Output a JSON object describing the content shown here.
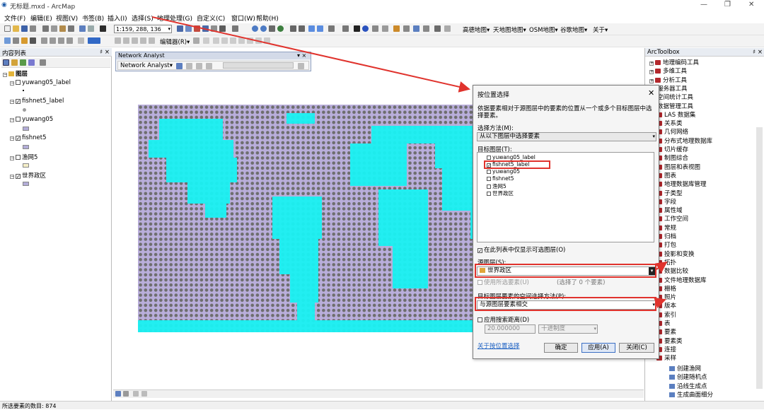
{
  "window": {
    "title": "无标题.mxd - ArcMap",
    "min": "—",
    "max": "❐",
    "close": "✕"
  },
  "menu": [
    "文件(F)",
    "编辑(E)",
    "视图(V)",
    "书签(B)",
    "插入(I)",
    "选择(S)",
    "地理处理(G)",
    "自定义(C)",
    "窗口(W)",
    "帮助(H)"
  ],
  "toolbar": {
    "scale": "1:159, 288, 136",
    "basemaps": [
      "高德地图▾",
      "天地图地图▾",
      "OSM地图▾",
      "谷歌地图▾",
      "关于▾"
    ],
    "editor": "编辑器(R)▾"
  },
  "toc": {
    "title": "内容列表",
    "pin": "♯ ×",
    "root": "图层",
    "layers": [
      {
        "name": "yuwang05_label",
        "checked": false,
        "sym": "#000000"
      },
      {
        "name": "fishnet5_label",
        "checked": true,
        "sym": "#9d9d9d"
      },
      {
        "name": "yuwang05",
        "checked": false,
        "sym": "#b3add8"
      },
      {
        "name": "fishnet5",
        "checked": true,
        "sym": "#b3add8"
      },
      {
        "name": "渔网5",
        "checked": false,
        "sym": "#f5efc8"
      },
      {
        "name": "世界政区",
        "checked": true,
        "sym": "#b3add8"
      }
    ]
  },
  "network": {
    "title": "Network Analyst",
    "close": "▾ ×",
    "label": "Network Analyst▾"
  },
  "status": {
    "count": "所选要素的数目: 874"
  },
  "toolbox": {
    "title": "ArcToolbox",
    "pin": "♯ ×",
    "items": [
      "地理编码工具",
      "多维工具",
      "分析工具",
      "服务器工具",
      "空间统计工具",
      "数据管理工具",
      "LAS 数据集",
      "关系类",
      "几何网络",
      "分布式地理数据库",
      "切片缓存",
      "制图综合",
      "图层和表视图",
      "图表",
      "地理数据库管理",
      "子类型",
      "字段",
      "属性域",
      "工作空间",
      "常规",
      "归档",
      "打包",
      "投影和变换",
      "拓扑",
      "数据比较",
      "文件地理数据库",
      "栅格",
      "照片",
      "版本",
      "索引",
      "表",
      "要素",
      "要素类",
      "连接",
      "采样"
    ],
    "subitems": [
      "创建渔网",
      "创建随机点",
      "沿线生成点",
      "生成曲面细分"
    ]
  },
  "dialog": {
    "title": "按位置选择",
    "close": "✕",
    "desc": "依据要素相对于源图层中的要素的位置从一个或多个目标图层中选择要素。",
    "method_label": "选择方法(M):",
    "method": "从以下图层中选择要素",
    "target_label": "目标图层(T):",
    "targets": [
      {
        "name": "yuwang05_label",
        "checked": false
      },
      {
        "name": "fishnet5_label",
        "checked": true
      },
      {
        "name": "yuwang05",
        "checked": false
      },
      {
        "name": "fishnet5",
        "checked": false
      },
      {
        "name": "渔网5",
        "checked": false
      },
      {
        "name": "世界政区",
        "checked": false
      }
    ],
    "only_selectable": "在此列表中仅显示可选图层(O)",
    "source_label": "源图层(S):",
    "source": "世界政区",
    "use_selected": "使用所选要素(U)",
    "selected_count": "(选择了 0 个要素)",
    "spatial_label": "目标图层要素的空间选择方法(P):",
    "spatial": "与源图层要素相交",
    "search_dist": "应用搜索距离(D)",
    "dist_value": "20.000000",
    "dist_unit": "十进制度",
    "help_link": "关于按位置选择",
    "ok": "确定",
    "apply": "应用(A)",
    "close_btn": "关闭(C)"
  },
  "colors": {
    "cyan": "#19f1f2",
    "lavender": "#b9aedb",
    "red": "#e0332d"
  }
}
